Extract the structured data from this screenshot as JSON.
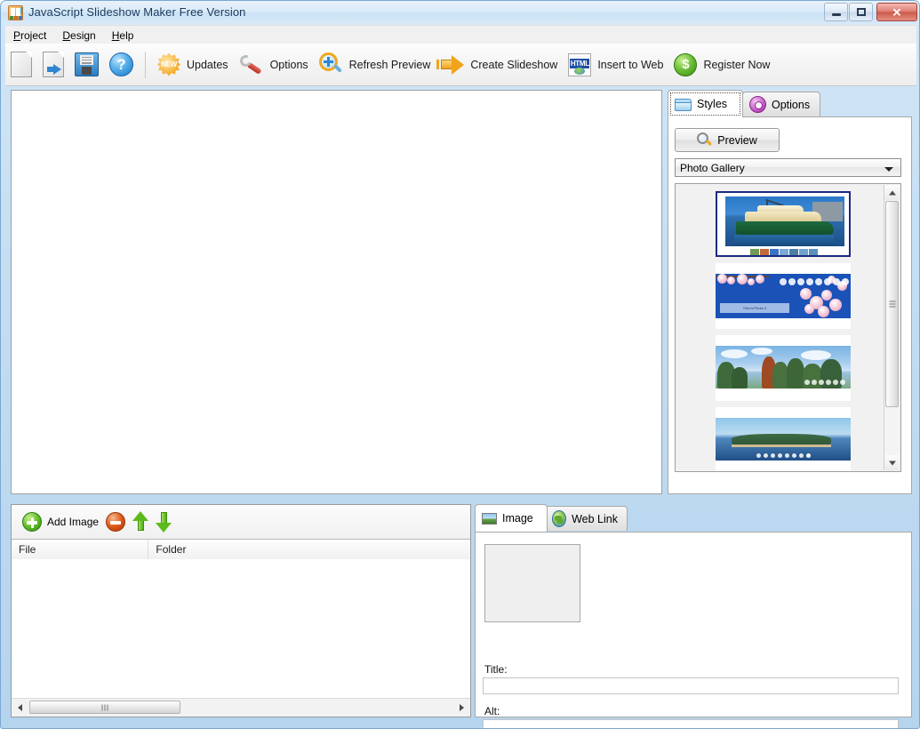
{
  "window": {
    "title": "JavaScript Slideshow Maker Free Version",
    "icon": "app-icon",
    "minimize_label": "",
    "maximize_label": "",
    "close_label": "✕"
  },
  "menu": {
    "items": [
      {
        "label": "Project",
        "accel": "P"
      },
      {
        "label": "Design",
        "accel": "D"
      },
      {
        "label": "Help",
        "accel": "H"
      }
    ]
  },
  "toolbar": {
    "buttons": [
      {
        "label": "",
        "icon": "new-project-icon"
      },
      {
        "label": "",
        "icon": "open-project-icon"
      },
      {
        "label": "",
        "icon": "save-project-icon"
      },
      {
        "label": "",
        "icon": "help-icon"
      },
      {
        "label": "Updates",
        "icon": "updates-new-icon"
      },
      {
        "label": "Options",
        "icon": "wrench-options-icon"
      },
      {
        "label": "Refresh Preview",
        "icon": "zoom-refresh-icon"
      },
      {
        "label": "Create Slideshow",
        "icon": "arrow-create-icon"
      },
      {
        "label": "Insert to Web",
        "icon": "html-insert-icon"
      },
      {
        "label": "Register Now",
        "icon": "dollar-register-icon"
      }
    ]
  },
  "styles_panel": {
    "tabs": [
      {
        "label": "Styles",
        "icon": "folder-icon",
        "active": true
      },
      {
        "label": "Options",
        "icon": "gear-icon",
        "active": false
      }
    ],
    "preview_button": "Preview",
    "style_select": {
      "value": "Photo Gallery",
      "options": [
        "Photo Gallery"
      ]
    },
    "thumbnails": [
      {
        "name": "photo-gallery-ferry",
        "selected": true
      },
      {
        "name": "blue-blossom-gallery",
        "selected": false
      },
      {
        "name": "autumn-trees-gallery",
        "selected": false
      },
      {
        "name": "island-gallery",
        "selected": false
      }
    ],
    "scroll": {
      "position_pct": 0
    }
  },
  "image_list": {
    "toolbar": {
      "add_label": "Add Image",
      "add_icon": "plus-circle-icon",
      "remove_icon": "minus-circle-icon",
      "move_up_icon": "arrow-up-icon",
      "move_down_icon": "arrow-down-icon"
    },
    "columns": [
      "File",
      "Folder"
    ],
    "rows": []
  },
  "properties_panel": {
    "tabs": [
      {
        "label": "Image",
        "icon": "photo-icon",
        "active": true
      },
      {
        "label": "Web Link",
        "icon": "globe-icon",
        "active": false
      }
    ],
    "preview_thumb": "image-preview-placeholder",
    "fields": [
      {
        "label": "Title:",
        "value": "",
        "name": "title-field"
      },
      {
        "label": "Alt:",
        "value": "",
        "name": "alt-field"
      }
    ]
  },
  "colors": {
    "window_frame": "#b5d4ee",
    "titlebar": "#d9eaf8",
    "toolbar_bg": "#f4f4f4",
    "selection_border": "#1b2a80",
    "close_button": "#cc5b4d"
  }
}
